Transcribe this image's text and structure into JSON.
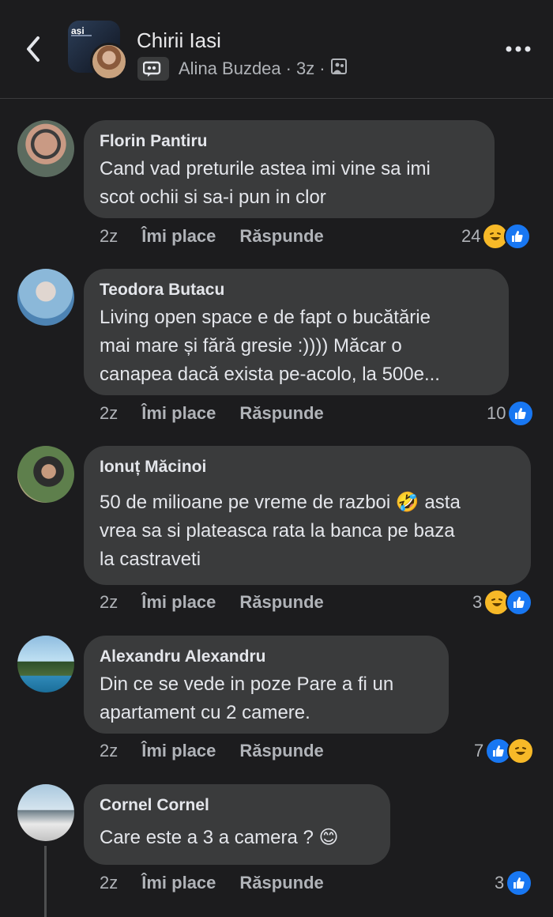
{
  "header": {
    "group_thumb_text": "ași",
    "title": "Chirii Iasi",
    "author": "Alina Buzdea",
    "time": "3z"
  },
  "comments": [
    {
      "name": "Florin Pantiru",
      "lines": [
        "Cand vad preturile astea imi vine sa imi",
        "scot ochii si sa-i pun in clor"
      ],
      "time": "2z",
      "like_label": "Îmi place",
      "reply_label": "Răspunde",
      "count": "24",
      "reactions": [
        "haha",
        "like"
      ]
    },
    {
      "name": "Teodora Butacu",
      "lines": [
        "Living open space e de fapt o bucătărie",
        "mai mare și fără gresie :)))) Măcar o",
        "canapea dacă exista pe-acolo, la 500e..."
      ],
      "time": "2z",
      "like_label": "Îmi place",
      "reply_label": "Răspunde",
      "count": "10",
      "reactions": [
        "like"
      ]
    },
    {
      "name": "Ionuț Măcinoi",
      "lines": [
        "50 de milioane pe vreme de razboi 🤣 asta",
        "vrea sa si plateasca rata la banca pe baza",
        "la castraveti"
      ],
      "time": "2z",
      "like_label": "Îmi place",
      "reply_label": "Răspunde",
      "count": "3",
      "reactions": [
        "haha",
        "like"
      ]
    },
    {
      "name": "Alexandru Alexandru",
      "lines": [
        "Din ce se vede in poze Pare a fi un",
        "apartament cu 2 camere."
      ],
      "time": "2z",
      "like_label": "Îmi place",
      "reply_label": "Răspunde",
      "count": "7",
      "reactions": [
        "like",
        "haha"
      ]
    },
    {
      "name": "Cornel Cornel",
      "lines": [
        "Care este a 3 a camera ? 😊"
      ],
      "time": "2z",
      "like_label": "Îmi place",
      "reply_label": "Răspunde",
      "count": "3",
      "reactions": [
        "like"
      ]
    }
  ],
  "colors": {
    "background": "#1c1c1e",
    "bubble": "#3a3b3c",
    "like_blue": "#1877f2",
    "haha_yellow": "#f7b928"
  }
}
